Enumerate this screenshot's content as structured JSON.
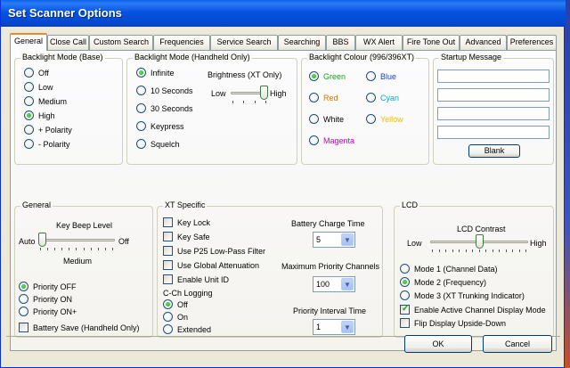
{
  "window": {
    "title": "Set Scanner Options"
  },
  "tabs": [
    {
      "label": "General",
      "active": true
    },
    {
      "label": "Close Call"
    },
    {
      "label": "Custom Search"
    },
    {
      "label": "Frequencies"
    },
    {
      "label": "Service Search"
    },
    {
      "label": "Searching"
    },
    {
      "label": "BBS"
    },
    {
      "label": "WX Alert"
    },
    {
      "label": "Fire Tone Out"
    },
    {
      "label": "Advanced"
    },
    {
      "label": "Preferences"
    }
  ],
  "backlight_base": {
    "title": "Backlight Mode (Base)",
    "options": [
      "Off",
      "Low",
      "Medium",
      "High",
      "+ Polarity",
      "- Polarity"
    ],
    "selected": "High"
  },
  "backlight_handheld": {
    "title": "Backlight Mode (Handheld Only)",
    "options": [
      "Infinite",
      "10 Seconds",
      "30 Seconds",
      "Keypress",
      "Squelch"
    ],
    "selected": "Infinite",
    "brightness_label": "Brightness (XT Only)",
    "brightness_low": "Low",
    "brightness_high": "High",
    "brightness_level": 1.0
  },
  "backlight_colour": {
    "title": "Backlight Colour (996/396XT)",
    "options": [
      {
        "label": "Green",
        "color": "#1a9c1a",
        "selected": true
      },
      {
        "label": "Blue",
        "color": "#1a3ec8"
      },
      {
        "label": "Red",
        "color": "#e07000"
      },
      {
        "label": "Cyan",
        "color": "#00b0c0"
      },
      {
        "label": "White",
        "color": "#000000"
      },
      {
        "label": "Yellow",
        "color": "#e8c000"
      },
      {
        "label": "Magenta",
        "color": "#c000c0"
      }
    ]
  },
  "startup": {
    "title": "Startup Message",
    "lines": [
      "",
      "",
      "",
      ""
    ],
    "blank_button": "Blank"
  },
  "general": {
    "title": "General",
    "key_beep_label": "Key Beep Level",
    "beep_auto": "Auto",
    "beep_off": "Off",
    "beep_medium": "Medium",
    "beep_level": 0.0,
    "priority_options": [
      "Priority OFF",
      "Priority ON",
      "Priority ON+"
    ],
    "priority_selected": "Priority OFF",
    "battery_save": "Battery Save (Handheld Only)"
  },
  "xt": {
    "title": "XT Specific",
    "checks": [
      "Key Lock",
      "Key Safe",
      "Use P25 Low-Pass Filter",
      "Use Global Attenuation",
      "Enable Unit ID"
    ],
    "cch_label": "C-Ch Logging",
    "cch_options": [
      "Off",
      "On",
      "Extended"
    ],
    "cch_selected": "Off",
    "battery_charge_label": "Battery Charge Time",
    "battery_charge_value": "5",
    "max_priority_label": "Maximum Priority Channels",
    "max_priority_value": "100",
    "priority_interval_label": "Priority Interval Time",
    "priority_interval_value": "1"
  },
  "lcd": {
    "title": "LCD",
    "contrast_label": "LCD Contrast",
    "contrast_low": "Low",
    "contrast_high": "High",
    "contrast_level": 0.5,
    "modes": [
      "Mode 1 (Channel Data)",
      "Mode 2 (Frequency)",
      "Mode 3 (XT Trunking Indicator)"
    ],
    "mode_selected": "Mode 2 (Frequency)",
    "active_channel": "Enable Active Channel Display Mode",
    "active_channel_checked": true,
    "flip": "Flip Display Upside-Down"
  },
  "buttons": {
    "ok": "OK",
    "cancel": "Cancel"
  }
}
